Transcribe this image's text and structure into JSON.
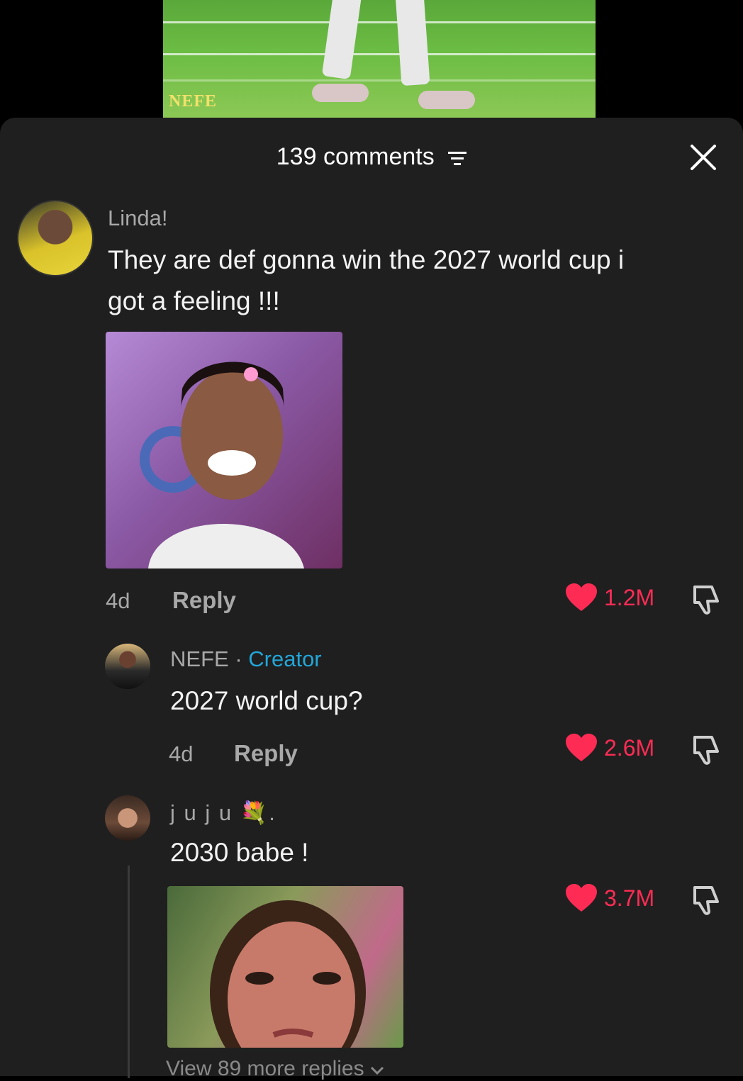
{
  "video": {
    "watermark": "NEFE"
  },
  "header": {
    "comment_count_label": "139 comments"
  },
  "comments": [
    {
      "username": "Linda!",
      "text_line1": "They are def gonna win the 2027 world cup i",
      "text_line2": "got a feeling !!!",
      "time": "4d",
      "reply_label": "Reply",
      "likes": "1.2M",
      "has_image": true
    },
    {
      "username": "NEFE",
      "separator": "·",
      "badge": "Creator",
      "text": "2027 world cup?",
      "time": "4d",
      "reply_label": "Reply",
      "likes": "2.6M"
    },
    {
      "username": "j u j u 💐.",
      "text": "2030 babe !",
      "likes": "3.7M",
      "has_image": true
    }
  ],
  "view_more_label": "View 89 more replies",
  "colors": {
    "like": "#fe2c55",
    "creator": "#23a6d8",
    "sheet_bg": "#1f1f1f"
  }
}
